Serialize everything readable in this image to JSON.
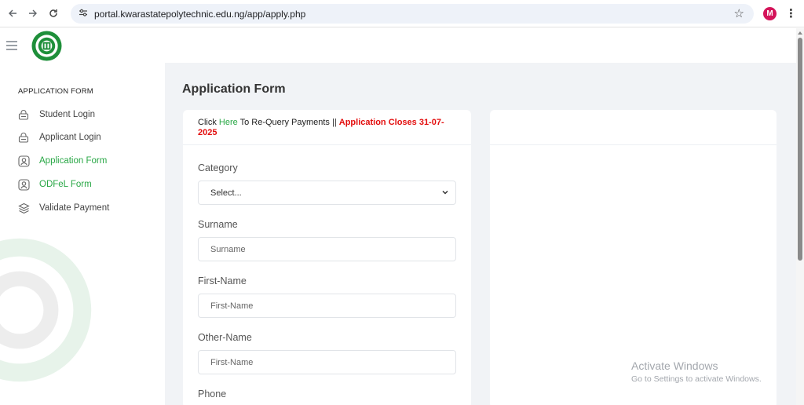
{
  "browser": {
    "url": "portal.kwarastatepolytechnic.edu.ng/app/apply.php",
    "profile_initial": "M",
    "icons": [
      "back-arrow-icon",
      "forward-arrow-icon",
      "reload-icon",
      "site-settings-icon",
      "bookmark-star-icon",
      "kebab-menu-icon"
    ]
  },
  "sidebar": {
    "title": "APPLICATION FORM",
    "items": [
      {
        "label": "Student Login",
        "icon": "lock-icon"
      },
      {
        "label": "Applicant Login",
        "icon": "lock-icon"
      },
      {
        "label": "Application Form",
        "icon": "user-square-icon"
      },
      {
        "label": "ODFeL Form",
        "icon": "user-square-icon"
      },
      {
        "label": "Validate Payment",
        "icon": "layers-icon"
      }
    ]
  },
  "main": {
    "title": "Application Form",
    "notice": {
      "prefix": "Click ",
      "link": "Here",
      "middle": " To Re-Query Payments || ",
      "deadline": "Application Closes 31-07-2025"
    },
    "form": {
      "category_label": "Category",
      "category_value": "Select...",
      "surname_label": "Surname",
      "surname_placeholder": "Surname",
      "firstname_label": "First-Name",
      "firstname_placeholder": "First-Name",
      "othername_label": "Other-Name",
      "othername_placeholder": "First-Name",
      "phone_label": "Phone"
    }
  },
  "activation": {
    "title": "Activate Windows",
    "subtitle": "Go to Settings to activate Windows."
  },
  "colors": {
    "accent_green": "#28a745",
    "deadline_red": "#e30d0d",
    "content_bg": "#f1f3f6",
    "url_bar": "#eef2f9",
    "avatar": "#d4145a"
  }
}
